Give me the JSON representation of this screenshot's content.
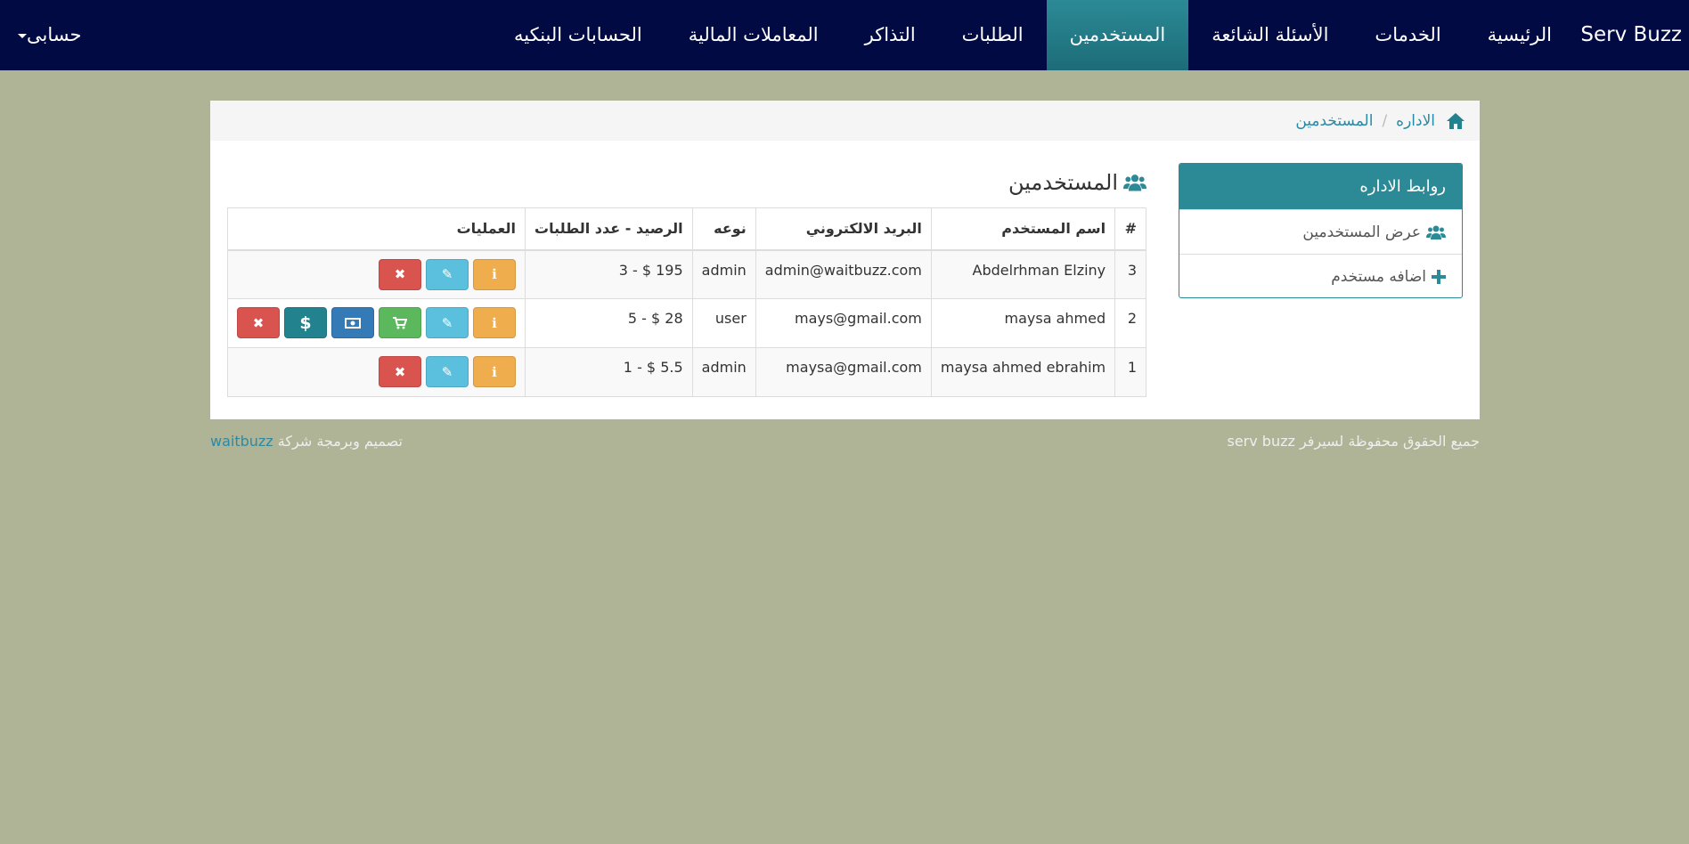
{
  "navbar": {
    "brand": "Serv Buzz",
    "items": [
      {
        "label": "الرئيسية",
        "active": false
      },
      {
        "label": "الخدمات",
        "active": false
      },
      {
        "label": "الأسئلة الشائعة",
        "active": false
      },
      {
        "label": "المستخدمين",
        "active": true
      },
      {
        "label": "الطلبات",
        "active": false
      },
      {
        "label": "التذاكر",
        "active": false
      },
      {
        "label": "المعاملات المالية",
        "active": false
      },
      {
        "label": "الحسابات البنكيه",
        "active": false
      }
    ],
    "account_label": "حسابى",
    "accent_color": "#2b8a96",
    "bg_color": "#020a44"
  },
  "breadcrumb": {
    "home_icon": "home-icon",
    "items": [
      "الاداره",
      "المستخدمين"
    ]
  },
  "sidebar": {
    "title": "روابط الاداره",
    "links": [
      {
        "label": "عرض المستخدمين",
        "icon": "users-icon"
      },
      {
        "label": "اضافه مستخدم",
        "icon": "plus-icon"
      }
    ]
  },
  "main": {
    "title": "المستخدمين",
    "title_icon": "users-icon",
    "table": {
      "headers": [
        "#",
        "اسم المستخدم",
        "البريد الالكتروني",
        "نوعه",
        "الرصيد - عدد الطلبات",
        "العمليات"
      ],
      "rows": [
        {
          "id": "3",
          "name": "Abdelrhman Elziny",
          "email": "admin@waitbuzz.com",
          "type": "admin",
          "balance": "3 - $ 195",
          "actions": [
            "info",
            "edit",
            "delete"
          ]
        },
        {
          "id": "2",
          "name": "maysa ahmed",
          "email": "mays@gmail.com",
          "type": "user",
          "balance": "5 - $ 28",
          "actions": [
            "info",
            "edit",
            "cart",
            "money",
            "dollar",
            "delete"
          ]
        },
        {
          "id": "1",
          "name": "maysa ahmed ebrahim",
          "email": "maysa@gmail.com",
          "type": "admin",
          "balance": "1 - $ 5.5",
          "actions": [
            "info",
            "edit",
            "delete"
          ]
        }
      ]
    }
  },
  "footer": {
    "copyright": "جميع الحقوق محفوظة لسيرفر serv buzz",
    "credit_prefix": "تصميم وبرمجة شركة",
    "credit_link": "waitbuzz"
  }
}
